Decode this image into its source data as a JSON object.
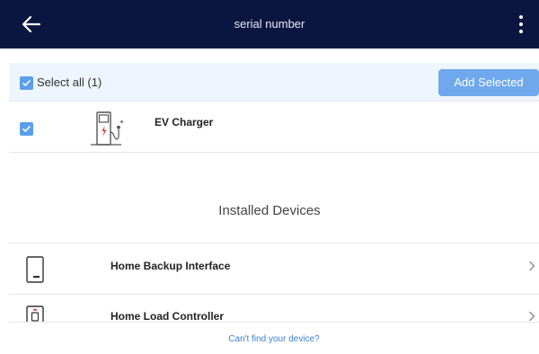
{
  "header": {
    "title": "serial number",
    "back_icon": "arrow-left-icon",
    "menu_icon": "more-vertical-icon",
    "background": "#0b1640"
  },
  "selection": {
    "select_all_label": "Select all (1)",
    "select_all_checked": true,
    "add_selected_label": "Add Selected",
    "accent": "#6fa8ec"
  },
  "found_devices": [
    {
      "name": "EV Charger",
      "icon": "ev-charger-icon",
      "checked": true
    }
  ],
  "installed": {
    "title": "Installed Devices",
    "items": [
      {
        "name": "Home Backup Interface",
        "icon": "backup-interface-icon"
      },
      {
        "name": "Home Load Controller",
        "icon": "load-controller-icon"
      }
    ]
  },
  "footer": {
    "link": "Can't find your device?",
    "link_color": "#3b7fd6"
  }
}
